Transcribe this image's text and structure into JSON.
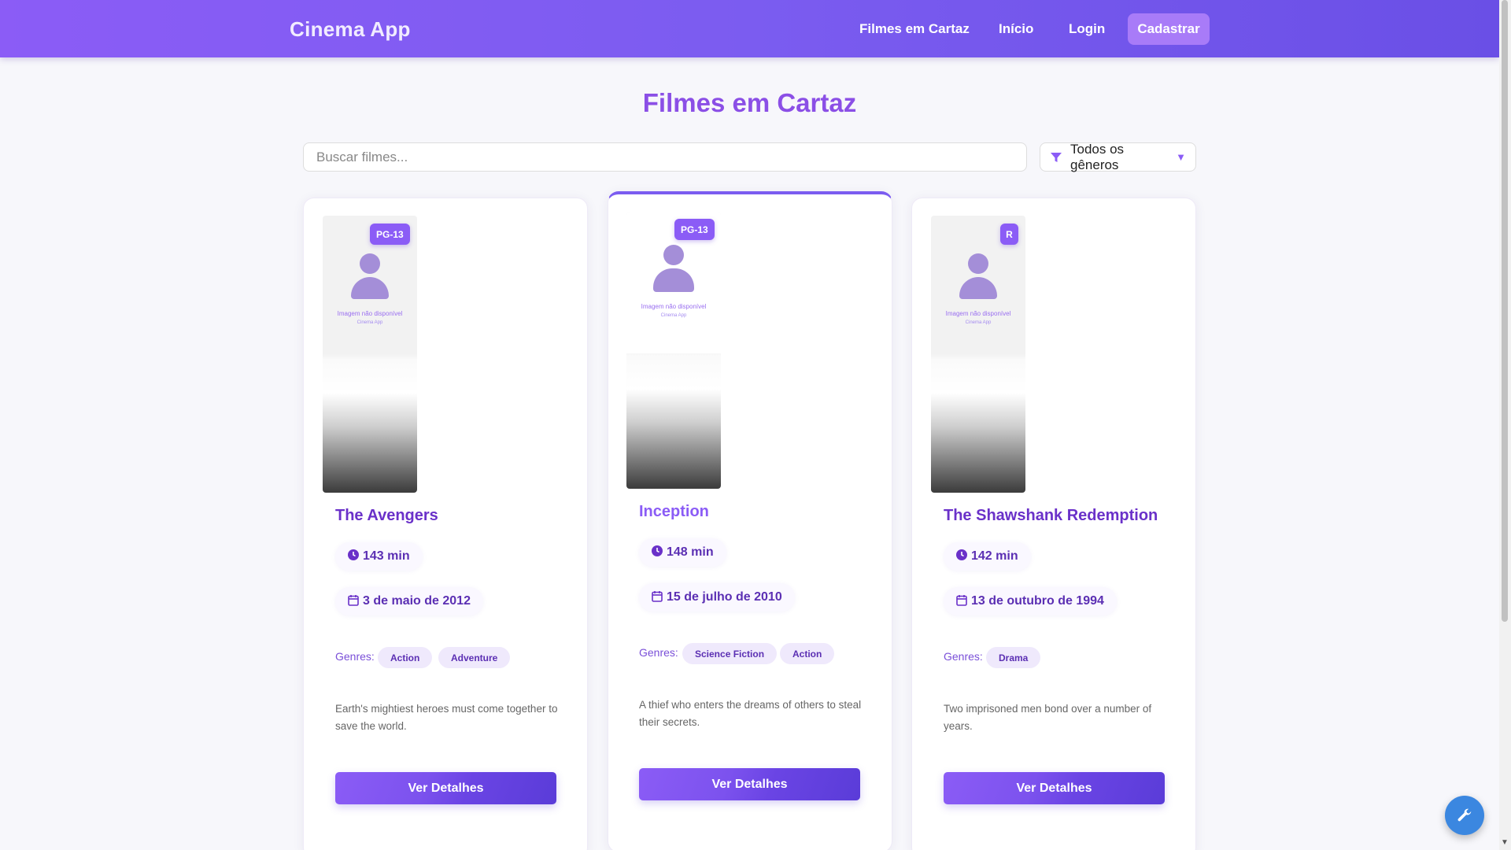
{
  "header": {
    "brand": "Cinema App",
    "nav": [
      "Filmes em Cartaz",
      "Início",
      "Login"
    ],
    "cta": "Cadastrar"
  },
  "main": {
    "title": "Filmes em Cartaz",
    "search_placeholder": "Buscar filmes...",
    "genre_filter": "Todos os gêneros",
    "genres_label": "Genres:",
    "details_label": "Ver Detalhes",
    "poster_placeholder": "Imagem não disponível",
    "poster_brand": "Cinema App"
  },
  "movies": [
    {
      "title": "The Avengers",
      "rating": "PG-13",
      "duration": "143 min",
      "date": "3 de maio de 2012",
      "genres": [
        "Action",
        "Adventure"
      ],
      "description": "Earth's mightiest heroes must come together to save the world."
    },
    {
      "title": "Inception",
      "rating": "PG-13",
      "duration": "148 min",
      "date": "15 de julho de 2010",
      "genres": [
        "Science Fiction",
        "Action"
      ],
      "description": "A thief who enters the dreams of others to steal their secrets."
    },
    {
      "title": "The Shawshank Redemption",
      "rating": "R",
      "duration": "142 min",
      "date": "13 de outubro de 1994",
      "genres": [
        "Drama"
      ],
      "description": "Two imprisoned men bond over a number of years."
    }
  ],
  "colors": {
    "accent": "#8b5cf6",
    "accent_dark": "#6a31c9",
    "fab": "#3b87e0"
  },
  "icons": {
    "duration": "clock-icon",
    "date": "calendar-icon",
    "filter": "filter-icon",
    "fab": "wrench-icon"
  }
}
